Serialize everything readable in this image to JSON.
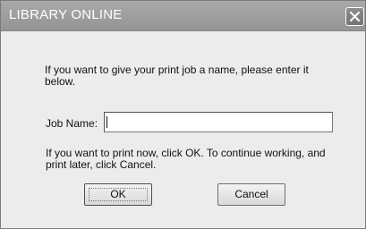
{
  "window": {
    "title": "LIBRARY ONLINE",
    "close_icon": "close-icon"
  },
  "dialog": {
    "instruction": "If you want to give your print job a name, please enter it below.",
    "job_name_label": "Job Name:",
    "job_name_value": "",
    "print_instruction": "If you want to print now, click OK.  To continue working, and print later, click Cancel.",
    "ok_label": "OK",
    "cancel_label": "Cancel"
  },
  "colors": {
    "titlebar": "#9e9e9e",
    "dialog_background": "#ececec",
    "title_text": "#ffffff"
  }
}
